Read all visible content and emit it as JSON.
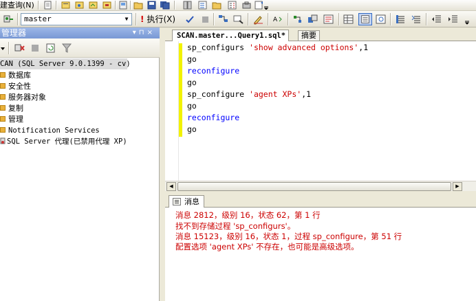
{
  "toolbar": {
    "menu_fragment": "建查询(N)",
    "database": "master",
    "execute_label": "执行(X)"
  },
  "object_explorer": {
    "title": "管理器",
    "server_node": "CAN (SQL Server 9.0.1399 - cv)",
    "items": [
      {
        "label": "数据库"
      },
      {
        "label": "安全性"
      },
      {
        "label": "服务器对象"
      },
      {
        "label": "复制"
      },
      {
        "label": "管理"
      },
      {
        "label": "Notification Services"
      },
      {
        "label": "SQL Server 代理(已禁用代理 XP)"
      }
    ]
  },
  "tabs": {
    "active": "SCAN.master...Query1.sql*",
    "inactive": "摘要"
  },
  "editor": {
    "lines": [
      {
        "a": "sp_configurs ",
        "b": "'show advanced options'",
        "c": ",1"
      },
      {
        "a": "go",
        "b": "",
        "c": ""
      },
      {
        "a": "reconfigure",
        "b": "",
        "c": ""
      },
      {
        "a": "go",
        "b": "",
        "c": ""
      },
      {
        "a": "sp_configure ",
        "b": "'agent XPs'",
        "c": ",1"
      },
      {
        "a": "go",
        "b": "",
        "c": ""
      },
      {
        "a": "reconfigure",
        "b": "",
        "c": ""
      },
      {
        "a": "go",
        "b": "",
        "c": ""
      }
    ]
  },
  "messages": {
    "tab_label": "消息",
    "lines": [
      "消息 2812，级别 16，状态 62，第 1 行",
      "找不到存储过程 'sp_configurs'。",
      "消息 15123，级别 16，状态 1，过程 sp_configure，第 51 行",
      "配置选项 'agent XPs' 不存在，也可能是高级选项。"
    ]
  },
  "colors": {
    "keyword": "#0000ff",
    "string": "#cc0000",
    "error": "#cc0000",
    "change_bar": "#f2f200"
  }
}
